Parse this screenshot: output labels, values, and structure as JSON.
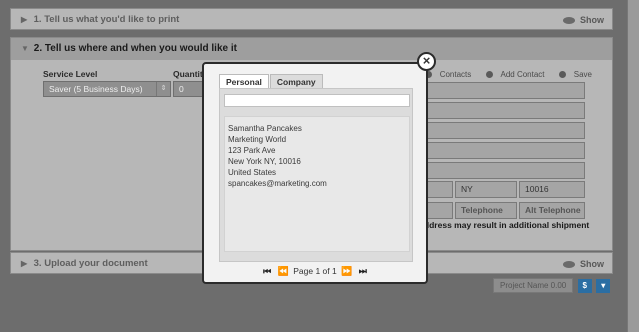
{
  "sections": {
    "s1": {
      "title": "1. Tell us what you'd like to print",
      "show_label": "Show"
    },
    "s2": {
      "title": "2. Tell us where and when you would like it"
    },
    "s3": {
      "title": "3. Upload your document",
      "show_label": "Show"
    }
  },
  "form": {
    "service_level_label": "Service Level",
    "service_level_value": "Saver (5 Business Days)",
    "quantity_label": "Quantity",
    "quantity_value": "0",
    "toolbar": {
      "contacts": "Contacts",
      "add_contact": "Add Contact",
      "save": "Save"
    },
    "state_value": "NY",
    "zip_value": "10016",
    "telephone_placeholder": "Telephone",
    "alt_telephone_placeholder": "Alt Telephone",
    "warning": "t address may result in additional shipment"
  },
  "footer": {
    "project_name": "Project Name 0.00",
    "dollar_btn": "$",
    "cart_btn": "▾"
  },
  "modal": {
    "close_glyph": "×",
    "tabs": [
      "Personal",
      "Company"
    ],
    "active_tab": "Personal",
    "search_value": "",
    "contact": {
      "name": "Samantha Pancakes",
      "company": "Marketing World",
      "street": "123 Park Ave",
      "city_line": "New York NY, 10016",
      "country": "United States",
      "email": "spancakes@marketing.com"
    },
    "pager": {
      "first": "⏮",
      "prev": "⏪",
      "text": "Page 1 of 1",
      "next": "⏩",
      "last": "⏭"
    }
  }
}
